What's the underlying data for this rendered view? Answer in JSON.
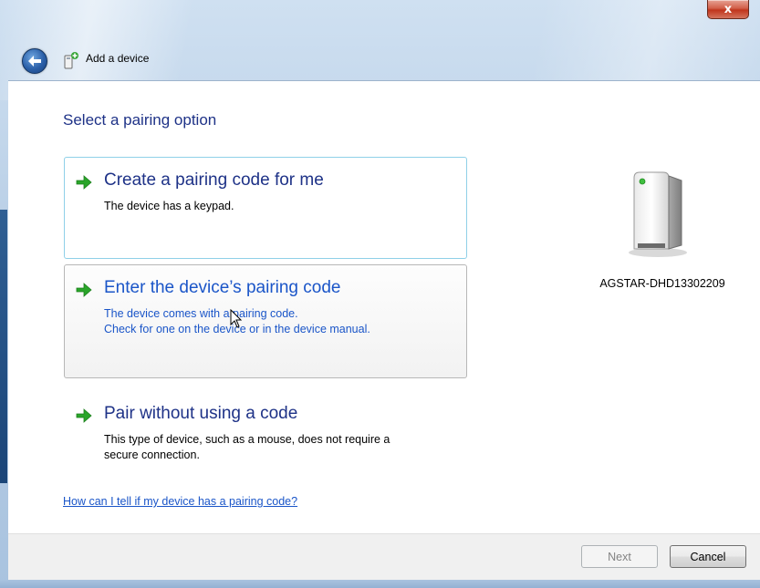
{
  "window": {
    "title": "Add a device",
    "close_label": "x"
  },
  "page": {
    "heading": "Select a pairing option",
    "options": [
      {
        "title": "Create a pairing code for me",
        "description": [
          "The device has a keypad."
        ]
      },
      {
        "title": "Enter the device’s pairing code",
        "description": [
          "The device comes with a pairing code.",
          "Check for one on the device or in the device manual."
        ]
      },
      {
        "title": "Pair without using a code",
        "description": [
          "This type of device, such as a mouse, does not require a",
          "secure connection."
        ]
      }
    ],
    "help_link": "How can I tell if my device has a pairing code?"
  },
  "device": {
    "name": "AGSTAR-DHD13302209",
    "icon": "storage-tower-icon"
  },
  "footer": {
    "next_label": "Next",
    "cancel_label": "Cancel"
  },
  "colors": {
    "heading": "#1e3287",
    "link": "#1a55c8",
    "arrow": "#2aa52a"
  }
}
